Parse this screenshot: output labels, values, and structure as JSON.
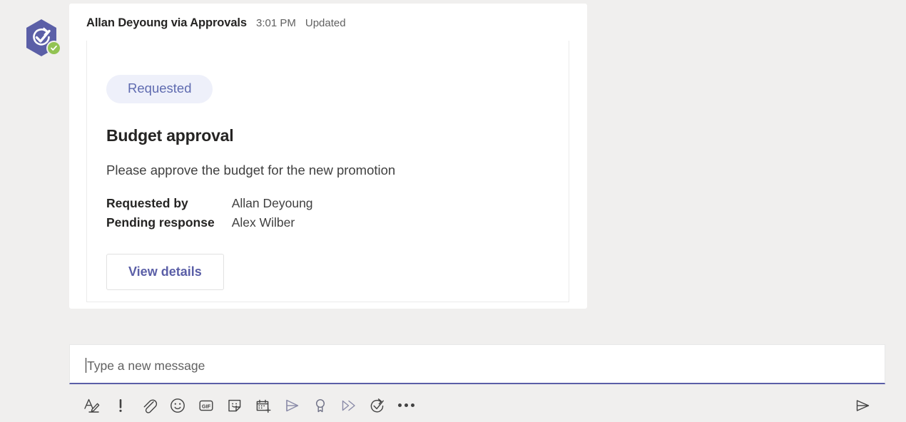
{
  "theme": {
    "background": "#f0efee",
    "accent_purple": "#5b5fa7",
    "pill_background": "#eef0fa",
    "pill_text": "#5f6bb0",
    "presence_green": "#92c353",
    "surface": "#ffffff"
  },
  "message": {
    "sender": "Allan Deyoung via Approvals",
    "time": "3:01 PM",
    "status": "Updated",
    "avatar_icon": "approvals-app-icon",
    "presence_icon": "available-presence-icon"
  },
  "card": {
    "status_pill": "Requested",
    "title": "Budget approval",
    "description": "Please approve the budget for the new promotion",
    "facts": [
      {
        "label": "Requested by",
        "value": "Allan Deyoung"
      },
      {
        "label": "Pending response",
        "value": "Alex Wilber"
      }
    ],
    "action_label": "View details"
  },
  "compose": {
    "placeholder": "Type a new message",
    "value": "",
    "toolbar": [
      {
        "name": "format-icon",
        "label": "Format"
      },
      {
        "name": "important-icon",
        "label": "Set delivery options"
      },
      {
        "name": "attach-icon",
        "label": "Attach"
      },
      {
        "name": "emoji-icon",
        "label": "Emoji"
      },
      {
        "name": "gif-icon",
        "label": "Giphy"
      },
      {
        "name": "sticker-icon",
        "label": "Sticker"
      },
      {
        "name": "schedule-meeting-icon",
        "label": "Schedule a meeting"
      },
      {
        "name": "stream-icon",
        "label": "Stream"
      },
      {
        "name": "praise-icon",
        "label": "Praise"
      },
      {
        "name": "forms-icon",
        "label": "Forms"
      },
      {
        "name": "approvals-icon",
        "label": "Approvals"
      },
      {
        "name": "more-options-icon",
        "label": "More options"
      }
    ],
    "send_label": "Send"
  }
}
